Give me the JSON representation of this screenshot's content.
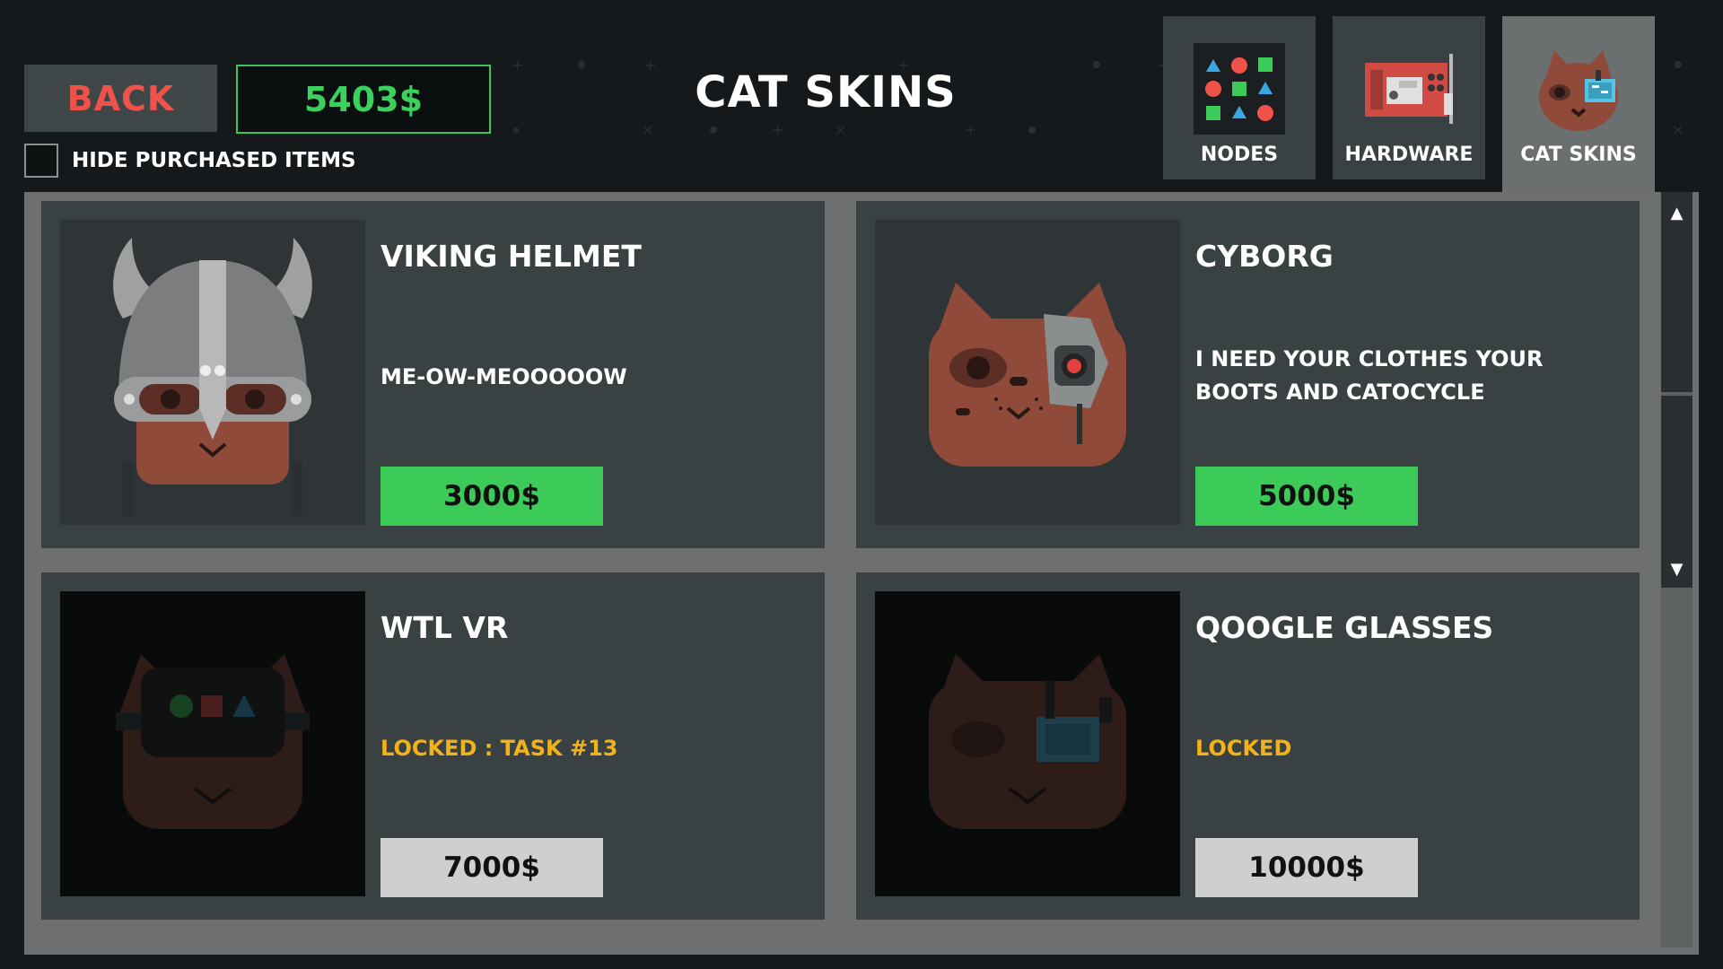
{
  "header": {
    "back_label": "BACK",
    "money": "5403$",
    "hide_purchased_label": "HIDE PURCHASED ITEMS",
    "title": "CAT SKINS"
  },
  "tabs": [
    {
      "label": "NODES",
      "icon": "nodes-icon"
    },
    {
      "label": "HARDWARE",
      "icon": "hardware-icon"
    },
    {
      "label": "CAT SKINS",
      "icon": "cat-skins-icon",
      "active": true
    }
  ],
  "items": [
    {
      "name": "VIKING HELMET",
      "description": "ME-OW-MEOOOOOW",
      "price": "3000$",
      "state": "available"
    },
    {
      "name": "CYBORG",
      "description": "I NEED YOUR CLOTHES YOUR BOOTS AND CATOCYCLE",
      "price": "5000$",
      "state": "available"
    },
    {
      "name": "WTL VR",
      "description": "LOCKED : TASK #13",
      "price": "7000$",
      "state": "locked"
    },
    {
      "name": "QOOGLE GLASSES",
      "description": "LOCKED",
      "price": "10000$",
      "state": "locked"
    }
  ],
  "colors": {
    "accent_green": "#3ccb58",
    "back_red": "#f0524a",
    "locked_yellow": "#f2b21a"
  }
}
